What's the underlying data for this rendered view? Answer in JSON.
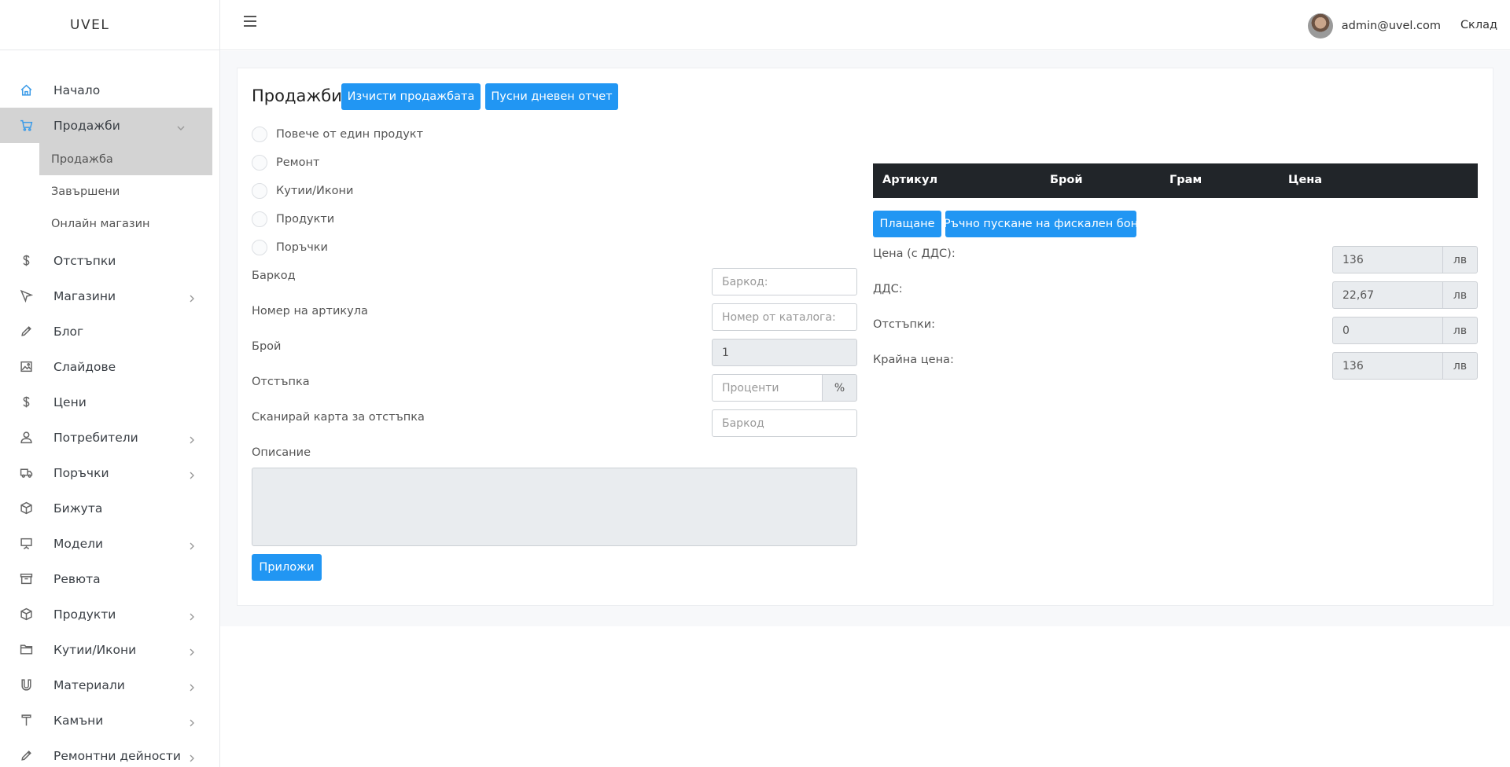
{
  "brand": "UVEL",
  "topbar": {
    "user_email": "admin@uvel.com",
    "store_label": "Склад"
  },
  "sidebar": {
    "items": [
      {
        "label": "Начало",
        "icon": "home-icon"
      },
      {
        "label": "Продажби",
        "icon": "cart-icon",
        "active": true,
        "expanded": true
      },
      {
        "label": "Отстъпки",
        "icon": "dollar-icon"
      },
      {
        "label": "Магазини",
        "icon": "cursor-icon"
      },
      {
        "label": "Блог",
        "icon": "pencil-icon"
      },
      {
        "label": "Слайдове",
        "icon": "image-icon"
      },
      {
        "label": "Цени",
        "icon": "dollar-icon"
      },
      {
        "label": "Потребители",
        "icon": "user-icon"
      },
      {
        "label": "Поръчки",
        "icon": "truck-icon"
      },
      {
        "label": "Бижута",
        "icon": "box-icon"
      },
      {
        "label": "Модели",
        "icon": "easel-icon"
      },
      {
        "label": "Ревюта",
        "icon": "archive-icon"
      },
      {
        "label": "Продукти",
        "icon": "box-icon"
      },
      {
        "label": "Кутии/Икони",
        "icon": "folder-icon"
      },
      {
        "label": "Материали",
        "icon": "magnet-icon"
      },
      {
        "label": "Камъни",
        "icon": "hammer-icon"
      },
      {
        "label": "Ремонтни дейности",
        "icon": "pencil-icon"
      }
    ],
    "sales_sub": [
      "Продажба",
      "Завършени",
      "Онлайн магазин"
    ]
  },
  "page": {
    "title": "Продажби",
    "clear_sale_btn": "Изчисти продажбата",
    "daily_report_btn": "Пусни дневен отчет"
  },
  "options": [
    "Повече от един продукт",
    "Ремонт",
    "Кутии/Икони",
    "Продукти",
    "Поръчки"
  ],
  "form": {
    "barcode_label": "Баркод",
    "barcode_placeholder": "Баркод:",
    "catalog_label": "Номер на артикула",
    "catalog_placeholder": "Номер от каталога:",
    "qty_label": "Брой",
    "qty_value": "1",
    "discount_label": "Отстъпка",
    "discount_placeholder": "Проценти",
    "discount_unit": "%",
    "card_label": "Сканирай карта за отстъпка",
    "card_placeholder": "Баркод",
    "description_label": "Описание",
    "apply_btn": "Приложи"
  },
  "table": {
    "headers": [
      "Артикул",
      "Брой",
      "Грам",
      "Цена"
    ]
  },
  "payment": {
    "pay_btn": "Плащане",
    "fiscal_btn": "Ръчно пускане на фискален бон",
    "currency": "лв",
    "price_vat_label": "Цена (с ДДС):",
    "price_vat_value": "136",
    "vat_label": "ДДС:",
    "vat_value": "22,67",
    "discounts_label": "Отстъпки:",
    "discounts_value": "0",
    "final_label": "Крайна цена:",
    "final_value": "136"
  }
}
